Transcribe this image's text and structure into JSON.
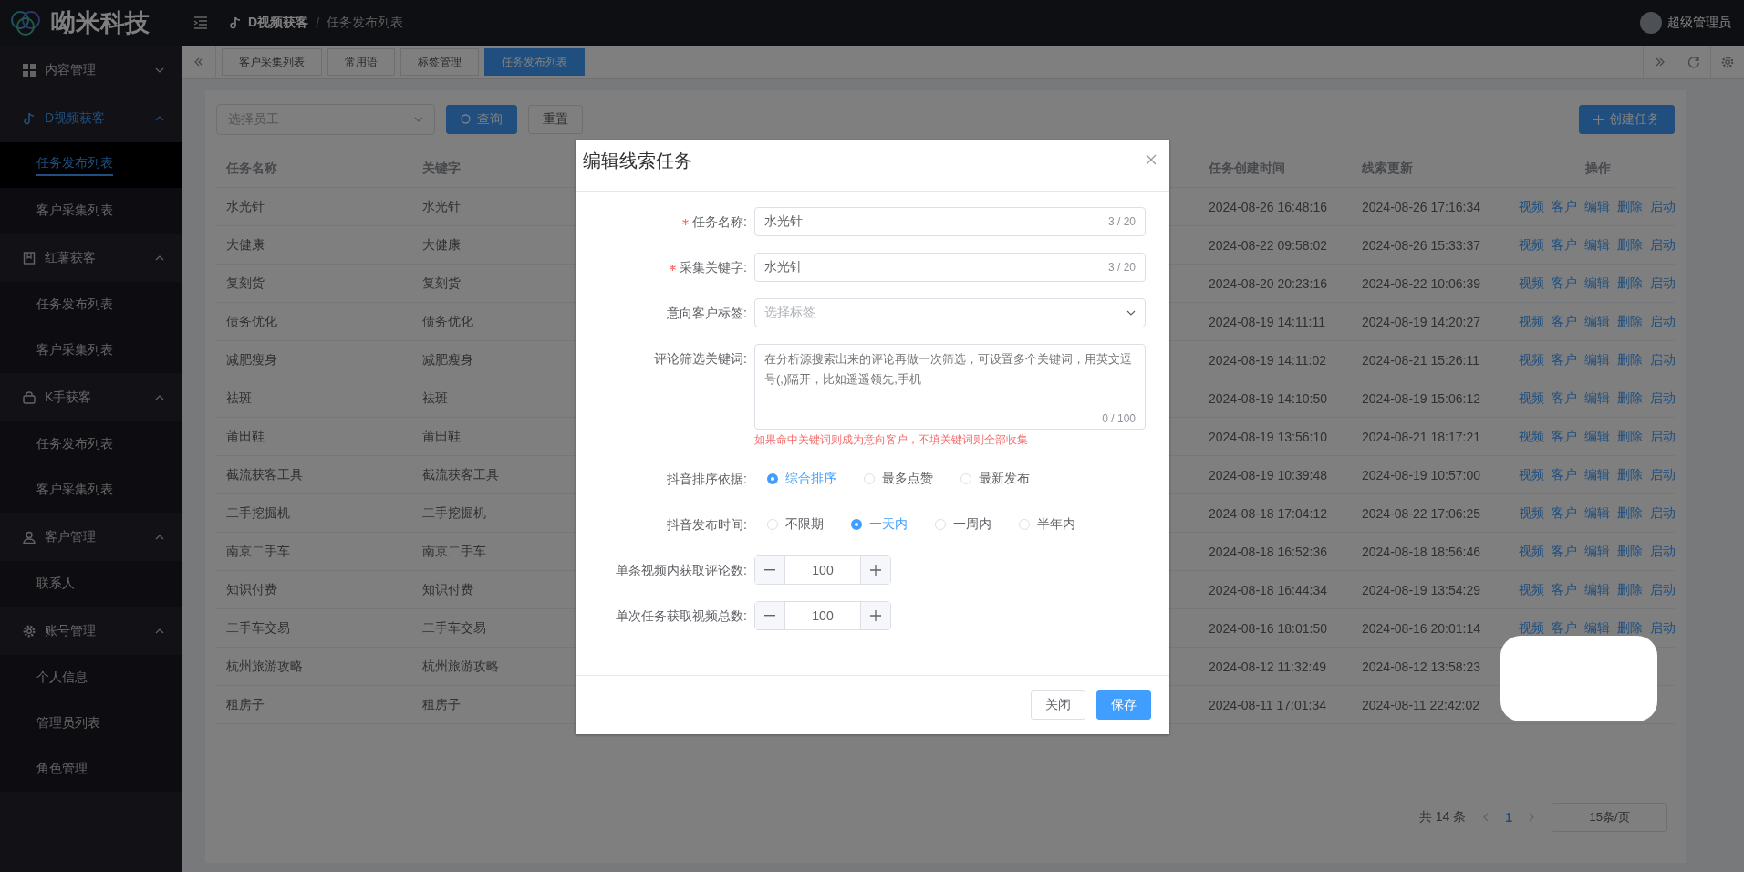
{
  "header": {
    "logo_text": "呦米科技",
    "breadcrumb_separator": "/",
    "breadcrumb": [
      {
        "label": "D视频获客"
      },
      {
        "label": "任务发布列表"
      }
    ],
    "user": "超级管理员"
  },
  "sidebar": {
    "groups": [
      {
        "label": "内容管理",
        "selected": false,
        "expanded": false
      },
      {
        "label": "D视频获客",
        "selected": true,
        "expanded": true,
        "children": [
          {
            "label": "任务发布列表",
            "selected": true
          },
          {
            "label": "客户采集列表",
            "selected": false
          }
        ]
      },
      {
        "label": "红薯获客",
        "selected": false,
        "expanded": true,
        "children": [
          {
            "label": "任务发布列表",
            "selected": false
          },
          {
            "label": "客户采集列表",
            "selected": false
          }
        ]
      },
      {
        "label": "K手获客",
        "selected": false,
        "expanded": true,
        "children": [
          {
            "label": "任务发布列表",
            "selected": false
          },
          {
            "label": "客户采集列表",
            "selected": false
          }
        ]
      },
      {
        "label": "客户管理",
        "selected": false,
        "expanded": true,
        "children": [
          {
            "label": "联系人",
            "selected": false
          }
        ]
      },
      {
        "label": "账号管理",
        "selected": false,
        "expanded": true,
        "children": [
          {
            "label": "个人信息",
            "selected": false
          },
          {
            "label": "管理员列表",
            "selected": false
          },
          {
            "label": "角色管理",
            "selected": false
          }
        ]
      }
    ]
  },
  "tabs": [
    {
      "label": "客户采集列表",
      "selected": false
    },
    {
      "label": "常用语",
      "selected": false
    },
    {
      "label": "标签管理",
      "selected": false
    },
    {
      "label": "任务发布列表",
      "selected": true
    }
  ],
  "toolbar": {
    "employee_select": {
      "placeholder": "选择员工"
    },
    "search_button": "查询",
    "reset_button": "重置",
    "create_button": "创建任务"
  },
  "table": {
    "columns": [
      "任务名称",
      "关键字",
      "任务创建时间",
      "线索更新",
      "操作"
    ],
    "rows": [
      {
        "name": "水光针",
        "keyword": "水光针",
        "created": "2024-08-26 16:48:16",
        "updated": "2024-08-26 17:16:34",
        "actions": [
          "视频",
          "客户",
          "编辑",
          "删除",
          "启动"
        ]
      },
      {
        "name": "大健康",
        "keyword": "大健康",
        "created": "2024-08-22 09:58:02",
        "updated": "2024-08-26 15:33:37",
        "actions": [
          "视频",
          "客户",
          "编辑",
          "删除",
          "启动"
        ]
      },
      {
        "name": "复刻货",
        "keyword": "复刻货",
        "created": "2024-08-20 20:23:16",
        "updated": "2024-08-22 10:06:39",
        "actions": [
          "视频",
          "客户",
          "编辑",
          "删除",
          "启动"
        ]
      },
      {
        "name": "债务优化",
        "keyword": "债务优化",
        "created": "2024-08-19 14:11:11",
        "updated": "2024-08-19 14:20:27",
        "actions": [
          "视频",
          "客户",
          "编辑",
          "删除",
          "启动"
        ]
      },
      {
        "name": "减肥瘦身",
        "keyword": "减肥瘦身",
        "created": "2024-08-19 14:11:02",
        "updated": "2024-08-21 15:26:11",
        "actions": [
          "视频",
          "客户",
          "编辑",
          "删除",
          "启动"
        ]
      },
      {
        "name": "祛斑",
        "keyword": "祛斑",
        "created": "2024-08-19 14:10:50",
        "updated": "2024-08-19 15:06:12",
        "actions": [
          "视频",
          "客户",
          "编辑",
          "删除",
          "启动"
        ]
      },
      {
        "name": "莆田鞋",
        "keyword": "莆田鞋",
        "created": "2024-08-19 13:56:10",
        "updated": "2024-08-21 18:17:21",
        "actions": [
          "视频",
          "客户",
          "编辑",
          "删除",
          "启动"
        ]
      },
      {
        "name": "截流获客工具",
        "keyword": "截流获客工具",
        "created": "2024-08-19 10:39:48",
        "updated": "2024-08-19 10:57:00",
        "actions": [
          "视频",
          "客户",
          "编辑",
          "删除",
          "启动"
        ]
      },
      {
        "name": "二手挖掘机",
        "keyword": "二手挖掘机",
        "created": "2024-08-18 17:04:12",
        "updated": "2024-08-22 17:06:25",
        "actions": [
          "视频",
          "客户",
          "编辑",
          "删除",
          "启动"
        ]
      },
      {
        "name": "南京二手车",
        "keyword": "南京二手车",
        "created": "2024-08-18 16:52:36",
        "updated": "2024-08-18 18:56:46",
        "actions": [
          "视频",
          "客户",
          "编辑",
          "删除",
          "启动"
        ]
      },
      {
        "name": "知识付费",
        "keyword": "知识付费",
        "created": "2024-08-18 16:44:34",
        "updated": "2024-08-19 13:54:29",
        "actions": [
          "视频",
          "客户",
          "编辑",
          "删除",
          "启动"
        ]
      },
      {
        "name": "二手车交易",
        "keyword": "二手车交易",
        "created": "2024-08-16 18:01:50",
        "updated": "2024-08-16 20:01:14",
        "actions": [
          "视频",
          "客户",
          "编辑",
          "删除",
          "启动"
        ]
      },
      {
        "name": "杭州旅游攻略",
        "keyword": "杭州旅游攻略",
        "created": "2024-08-12 11:32:49",
        "updated": "2024-08-12 13:58:23"
      },
      {
        "name": "租房子",
        "keyword": "租房子",
        "created": "2024-08-11 17:01:34",
        "updated": "2024-08-11 22:42:02"
      }
    ]
  },
  "pagination": {
    "total": "共 14 条",
    "pages": [
      {
        "label": "1",
        "selected": true
      }
    ],
    "page_size": "15条/页"
  },
  "dialog": {
    "title": "编辑线索任务",
    "fields": [
      {
        "kind": "text",
        "label": "任务名称:",
        "required": true,
        "value": "水光针",
        "counter": "3 / 20"
      },
      {
        "kind": "text",
        "label": "采集关键字:",
        "required": true,
        "value": "水光针",
        "counter": "3 / 20"
      },
      {
        "kind": "select",
        "label": "意向客户标签:",
        "required": false,
        "placeholder": "选择标签"
      },
      {
        "kind": "textarea",
        "label": "评论筛选关键词:",
        "required": false,
        "placeholder": "在分析源搜索出来的评论再做一次筛选，可设置多个关键词，用英文逗号(,)隔开，比如遥遥领先,手机",
        "counter": "0 / 100",
        "hint": "如果命中关键词则成为意向客户，不填关键词则全部收集"
      },
      {
        "kind": "radio",
        "label": "抖音排序依据:",
        "required": false,
        "options": [
          {
            "label": "综合排序",
            "selected": true
          },
          {
            "label": "最多点赞",
            "selected": false
          },
          {
            "label": "最新发布",
            "selected": false
          }
        ]
      },
      {
        "kind": "radio",
        "label": "抖音发布时间:",
        "required": false,
        "options": [
          {
            "label": "不限期",
            "selected": false
          },
          {
            "label": "一天内",
            "selected": true
          },
          {
            "label": "一周内",
            "selected": false
          },
          {
            "label": "半年内",
            "selected": false
          }
        ]
      },
      {
        "kind": "number",
        "label": "单条视频内获取评论数:",
        "required": false,
        "value": "100"
      },
      {
        "kind": "number",
        "label": "单次任务获取视频总数:",
        "required": false,
        "value": "100"
      }
    ],
    "buttons": [
      {
        "label": "关闭",
        "kind": "default"
      },
      {
        "label": "保存",
        "kind": "primary"
      }
    ]
  }
}
